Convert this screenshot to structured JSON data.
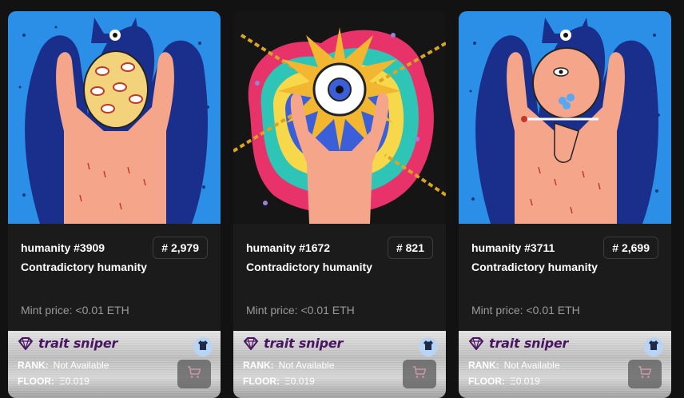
{
  "cards": [
    {
      "name": "humanity #3909",
      "rank": "# 2,979",
      "collection": "Contradictory humanity",
      "mint_label": "Mint price:",
      "mint_value": "<0.01 ETH",
      "sniper": {
        "brand": "trait sniper",
        "rank_label": "RANK:",
        "rank_value": "Not Available",
        "floor_label": "FLOOR:",
        "floor_value": "Ξ0.019"
      },
      "colors": {
        "background": "#2b8fe8",
        "accent": "#1a2f8c"
      }
    },
    {
      "name": "humanity #1672",
      "rank": "# 821",
      "collection": "Contradictory humanity",
      "mint_label": "Mint price:",
      "mint_value": "<0.01 ETH",
      "sniper": {
        "brand": "trait sniper",
        "rank_label": "RANK:",
        "rank_value": "Not Available",
        "floor_label": "FLOOR:",
        "floor_value": "Ξ0.019"
      },
      "colors": {
        "background": "#151515",
        "accent": "#f2b630"
      }
    },
    {
      "name": "humanity #3711",
      "rank": "# 2,699",
      "collection": "Contradictory humanity",
      "mint_label": "Mint price:",
      "mint_value": "<0.01 ETH",
      "sniper": {
        "brand": "trait sniper",
        "rank_label": "RANK:",
        "rank_value": "Not Available",
        "floor_label": "FLOOR:",
        "floor_value": "Ξ0.019"
      },
      "colors": {
        "background": "#2b8fe8",
        "accent": "#1a2f8c"
      }
    }
  ],
  "icons": {
    "diamond": "diamond-icon",
    "shirt": "shirt-icon",
    "cart": "cart-icon"
  }
}
